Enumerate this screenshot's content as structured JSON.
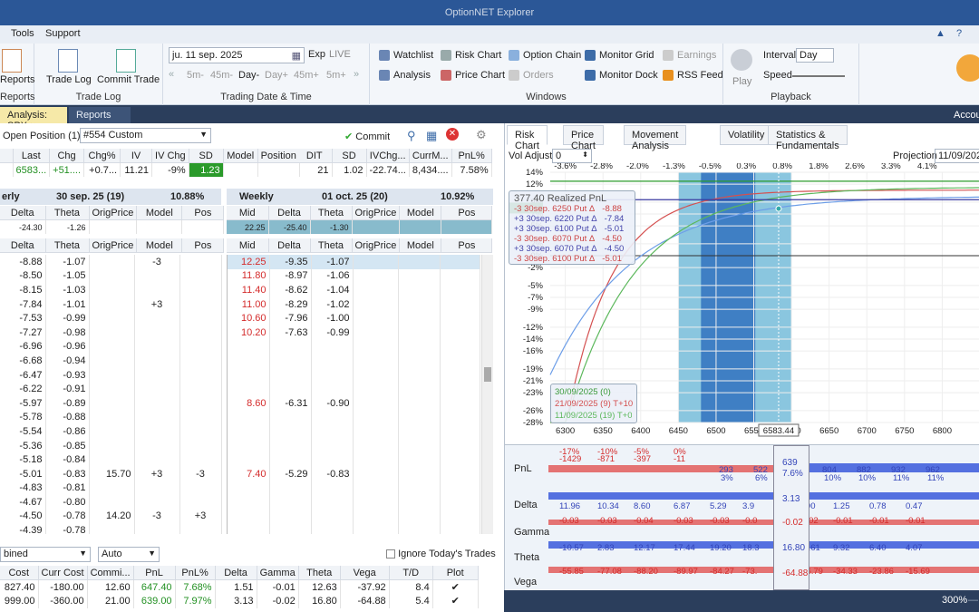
{
  "window": {
    "title": "OptionNET Explorer"
  },
  "menu": [
    "Tools",
    "Support"
  ],
  "ribbon": {
    "reports": {
      "label": "Reports",
      "caption": "Reports"
    },
    "tradelog": {
      "trade_log": "Trade Log",
      "commit_trade": "Commit Trade",
      "caption": "Trade Log"
    },
    "trading_date": {
      "date": "ju. 11 sep. 2025",
      "exp": "Exp",
      "live": "LIVE",
      "steps": [
        "5m-",
        "45m-",
        "Day-",
        "Day+",
        "45m+",
        "5m+"
      ],
      "caption": "Trading Date & Time"
    },
    "windows": {
      "watchlist": "Watchlist",
      "risk_chart": "Risk Chart",
      "option_chain": "Option Chain",
      "monitor_grid": "Monitor Grid",
      "earnings": "Earnings",
      "analysis": "Analysis",
      "price_chart": "Price Chart",
      "orders": "Orders",
      "monitor_dock": "Monitor Dock",
      "rss_feed": "RSS Feed",
      "caption": "Windows"
    },
    "playback": {
      "play": "Play",
      "interval_label": "Interval",
      "interval_value": "Day",
      "speed_label": "Speed",
      "caption": "Playback"
    }
  },
  "doc_tabs": {
    "active": "Analysis: SPX",
    "other": "Reports",
    "right": "Account"
  },
  "left": {
    "open_position_label": "Open Position (1)",
    "position_select": "#554 Custom",
    "commit": "Commit",
    "quote_headers": [
      "Last",
      "Chg",
      "Chg%",
      "IV",
      "IV Chg",
      "SD",
      "Model",
      "Position"
    ],
    "quote_values": [
      "6583...",
      "+51....",
      "+0.7...",
      "11.21",
      "-9%",
      "1.23",
      "",
      ""
    ],
    "stats_headers": [
      "DIT",
      "SD",
      "IVChg...",
      "CurrM...",
      "PnL%"
    ],
    "stats_values": [
      "21",
      "1.02",
      "-22.74...",
      "8,434....",
      "7.58%"
    ],
    "exp1": {
      "name": "erly",
      "date": "30 sep. 25 (19)",
      "iv": "10.88%"
    },
    "exp2": {
      "name": "Weekly",
      "date": "01 oct. 25 (20)",
      "iv": "10.92%"
    },
    "chain_headers_left": [
      "Delta",
      "Theta",
      "OrigPrice",
      "Model",
      "Pos"
    ],
    "chain_headers_right": [
      "Mid",
      "Delta",
      "Theta",
      "OrigPrice",
      "Model",
      "Pos"
    ],
    "partial_row_left": [
      "-24.30",
      "-1.26"
    ],
    "partial_row_right": [
      "22.25",
      "-25.40",
      "-1.30"
    ],
    "rows_left": [
      [
        "-8.88",
        "-1.07",
        "",
        "-3",
        ""
      ],
      [
        "-8.50",
        "-1.05",
        "",
        "",
        ""
      ],
      [
        "-8.15",
        "-1.03",
        "",
        "",
        ""
      ],
      [
        "-7.84",
        "-1.01",
        "",
        "+3",
        ""
      ],
      [
        "-7.53",
        "-0.99",
        "",
        "",
        ""
      ],
      [
        "-7.27",
        "-0.98",
        "",
        "",
        ""
      ],
      [
        "-6.96",
        "-0.96",
        "",
        "",
        ""
      ],
      [
        "-6.68",
        "-0.94",
        "",
        "",
        ""
      ],
      [
        "-6.47",
        "-0.93",
        "",
        "",
        ""
      ],
      [
        "-6.22",
        "-0.91",
        "",
        "",
        ""
      ],
      [
        "-5.97",
        "-0.89",
        "",
        "",
        ""
      ],
      [
        "-5.78",
        "-0.88",
        "",
        "",
        ""
      ],
      [
        "-5.54",
        "-0.86",
        "",
        "",
        ""
      ],
      [
        "-5.36",
        "-0.85",
        "",
        "",
        ""
      ],
      [
        "-5.18",
        "-0.84",
        "",
        "",
        ""
      ],
      [
        "-5.01",
        "-0.83",
        "15.70",
        "+3",
        "-3"
      ],
      [
        "-4.83",
        "-0.81",
        "",
        "",
        ""
      ],
      [
        "-4.67",
        "-0.80",
        "",
        "",
        ""
      ],
      [
        "-4.50",
        "-0.78",
        "14.20",
        "-3",
        "+3"
      ],
      [
        "-4.39",
        "-0.78",
        "",
        "",
        ""
      ]
    ],
    "rows_right": [
      [
        "12.25",
        "-9.35",
        "-1.07",
        "",
        "",
        ""
      ],
      [
        "11.80",
        "-8.97",
        "-1.06",
        "",
        "",
        ""
      ],
      [
        "11.40",
        "-8.62",
        "-1.04",
        "",
        "",
        ""
      ],
      [
        "11.00",
        "-8.29",
        "-1.02",
        "",
        "",
        ""
      ],
      [
        "10.60",
        "-7.96",
        "-1.00",
        "",
        "",
        ""
      ],
      [
        "10.20",
        "-7.63",
        "-0.99",
        "",
        "",
        ""
      ],
      [
        "",
        "",
        "",
        "",
        "",
        ""
      ],
      [
        "",
        "",
        "",
        "",
        "",
        ""
      ],
      [
        "",
        "",
        "",
        "",
        "",
        ""
      ],
      [
        "",
        "",
        "",
        "",
        "",
        ""
      ],
      [
        "8.60",
        "-6.31",
        "-0.90",
        "",
        "",
        ""
      ],
      [
        "",
        "",
        "",
        "",
        "",
        ""
      ],
      [
        "",
        "",
        "",
        "",
        "",
        ""
      ],
      [
        "",
        "",
        "",
        "",
        "",
        ""
      ],
      [
        "",
        "",
        "",
        "",
        "",
        ""
      ],
      [
        "7.40",
        "-5.29",
        "-0.83",
        "",
        "",
        ""
      ],
      [
        "",
        "",
        "",
        "",
        "",
        ""
      ],
      [
        "",
        "",
        "",
        "",
        "",
        ""
      ],
      [
        "",
        "",
        "",
        "",
        "",
        ""
      ],
      [
        "",
        "",
        "",
        "",
        "",
        ""
      ]
    ],
    "bottom_select1": "bined",
    "bottom_select2": "Auto",
    "ignore_today": "Ignore Today's Trades",
    "summary_headers": [
      "Cost",
      "Curr Cost",
      "Commi...",
      "PnL",
      "PnL%",
      "Delta",
      "Gamma",
      "Theta",
      "Vega",
      "T/D",
      "Plot"
    ],
    "summary_rows": [
      [
        "827.40",
        "-180.00",
        "12.60",
        "647.40",
        "7.68%",
        "1.51",
        "-0.01",
        "12.63",
        "-37.92",
        "8.4",
        "✔"
      ],
      [
        "999.00",
        "-360.00",
        "21.00",
        "639.00",
        "7.97%",
        "3.13",
        "-0.02",
        "16.80",
        "-64.88",
        "5.4",
        "✔"
      ]
    ]
  },
  "right": {
    "tabs": [
      "Risk Chart",
      "Price Chart",
      "Movement Analysis",
      "Volatility",
      "Statistics & Fundamentals"
    ],
    "vol_adjust_label": "Vol Adjust",
    "vol_adjust_value": "0",
    "projection_label": "Projection",
    "projection_value": "11/09/202",
    "pct_top": [
      "-3.6%",
      "-2.8%",
      "-2.0%",
      "-1.3%",
      "-0.5%",
      "0.3%",
      "0.8%",
      "1.8%",
      "2.6%",
      "3.3%",
      "4.1%"
    ],
    "y_ticks": [
      "14%",
      "12%",
      "9%",
      "7%",
      "5%",
      "2%",
      "0%",
      "-2%",
      "-5%",
      "-7%",
      "-9%",
      "-12%",
      "-14%",
      "-16%",
      "-19%",
      "-21%",
      "-23%",
      "-26%",
      "-28%"
    ],
    "x_ticks": [
      "6300",
      "6350",
      "6400",
      "6450",
      "6500",
      "6550",
      "6600",
      "6650",
      "6700",
      "6750",
      "6800"
    ],
    "price_label": "6583.44",
    "y_marker": "8%",
    "legend_title": "377.40 Realized PnL",
    "legend": [
      {
        "text": "-3 30sep. 6250 Put Δ",
        "val": "-8.88",
        "color": "#c44"
      },
      {
        "text": "+3 30sep. 6220 Put Δ",
        "val": "-7.84",
        "color": "#44a"
      },
      {
        "text": "+3 30sep. 6100 Put Δ",
        "val": "-5.01",
        "color": "#44a"
      },
      {
        "text": "-3 30sep. 6070 Put Δ",
        "val": "-4.50",
        "color": "#c44"
      },
      {
        "text": "+3 30sep. 6070 Put Δ",
        "val": "-4.50",
        "color": "#44a"
      },
      {
        "text": "-3 30sep. 6100 Put Δ",
        "val": "-5.01",
        "color": "#c44"
      }
    ],
    "date_legend": [
      {
        "text": "30/09/2025 (0)",
        "color": "#3a9a3a"
      },
      {
        "text": "21/09/2025 (9) T+10",
        "color": "#d45050"
      },
      {
        "text": "11/09/2025 (19) T+0",
        "color": "#5cb85c"
      }
    ],
    "greeks": {
      "labels": [
        "PnL",
        "Delta",
        "Gamma",
        "Theta",
        "Vega"
      ],
      "pnl_top": [
        "-17%",
        "-10%",
        "-5%",
        "0%"
      ],
      "pnl_top2": [
        "-1429",
        "-871",
        "-397",
        "-11"
      ],
      "pnl_bottom": [
        "293",
        "522",
        "",
        "804",
        "882",
        "932",
        "962"
      ],
      "pnl_bottom2": [
        "3%",
        "6%",
        "",
        "10%",
        "10%",
        "11%",
        "11%"
      ],
      "delta": [
        "11.96",
        "10.34",
        "8.60",
        "6.87",
        "5.29",
        "3.9",
        "",
        "1.90",
        "1.25",
        "0.78",
        "0.47"
      ],
      "gamma": [
        "-0.03",
        "-0.03",
        "-0.04",
        "-0.03",
        "-0.03",
        "-0.0",
        "",
        "-0.02",
        "-0.01",
        "-0.01",
        "-0.01"
      ],
      "theta": [
        "-10.57",
        "2.83",
        "12.17",
        "17.44",
        "19.20",
        "18.3",
        "",
        "12.61",
        "9.32",
        "6.40",
        "4.07"
      ],
      "vega": [
        "-55.85",
        "-77.08",
        "-88.20",
        "-89.97",
        "-84.27",
        "-73.",
        "",
        "-46.79",
        "-34.33",
        "-23.86",
        "-15.69"
      ],
      "center": {
        "pnl": "639",
        "pnl_pct": "7.6%",
        "delta": "3.13",
        "gamma": "-0.02",
        "theta": "16.80",
        "vega": "-64.88"
      }
    },
    "zoom": "300%"
  }
}
